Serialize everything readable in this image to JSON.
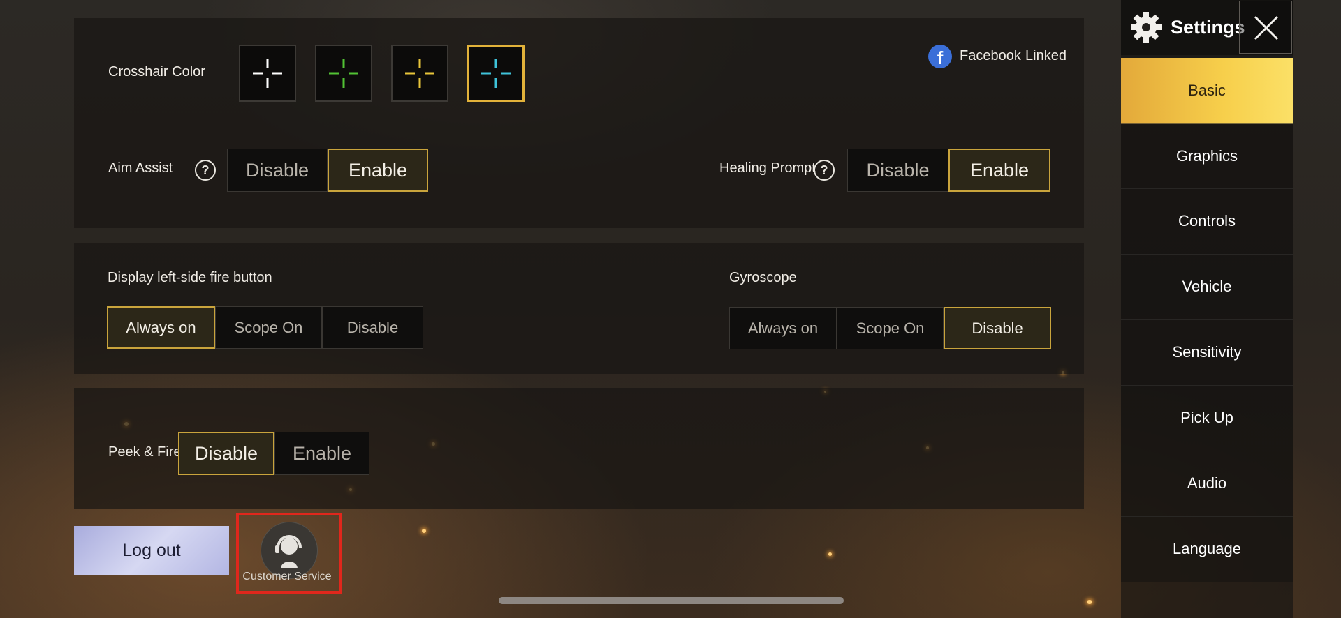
{
  "settings_title": "Settings",
  "facebook": {
    "label": "Facebook",
    "status": "Linked"
  },
  "crosshair": {
    "label": "Crosshair Color",
    "colors": [
      "#ffffff",
      "#52c234",
      "#e8c53a",
      "#3fc3d9"
    ],
    "selected_index": 3
  },
  "aim_assist": {
    "label": "Aim Assist",
    "options": [
      "Disable",
      "Enable"
    ],
    "selected": "Enable"
  },
  "healing_prompt": {
    "label": "Healing Prompt",
    "options": [
      "Disable",
      "Enable"
    ],
    "selected": "Enable"
  },
  "left_fire": {
    "label": "Display left-side fire button",
    "options": [
      "Always on",
      "Scope On",
      "Disable"
    ],
    "selected": "Always on"
  },
  "gyroscope": {
    "label": "Gyroscope",
    "options": [
      "Always on",
      "Scope On",
      "Disable"
    ],
    "selected": "Disable"
  },
  "peek_fire": {
    "label": "Peek & Fire",
    "options": [
      "Disable",
      "Enable"
    ],
    "selected": "Disable"
  },
  "logout_label": "Log out",
  "customer_service_label": "Customer Service",
  "nav": {
    "items": [
      "Basic",
      "Graphics",
      "Controls",
      "Vehicle",
      "Sensitivity",
      "Pick Up",
      "Audio",
      "Language"
    ],
    "active": "Basic"
  },
  "colors": {
    "accent": "#c9a43c",
    "active_tab": "#f7cf4b",
    "highlight_box": "#e0271c"
  }
}
